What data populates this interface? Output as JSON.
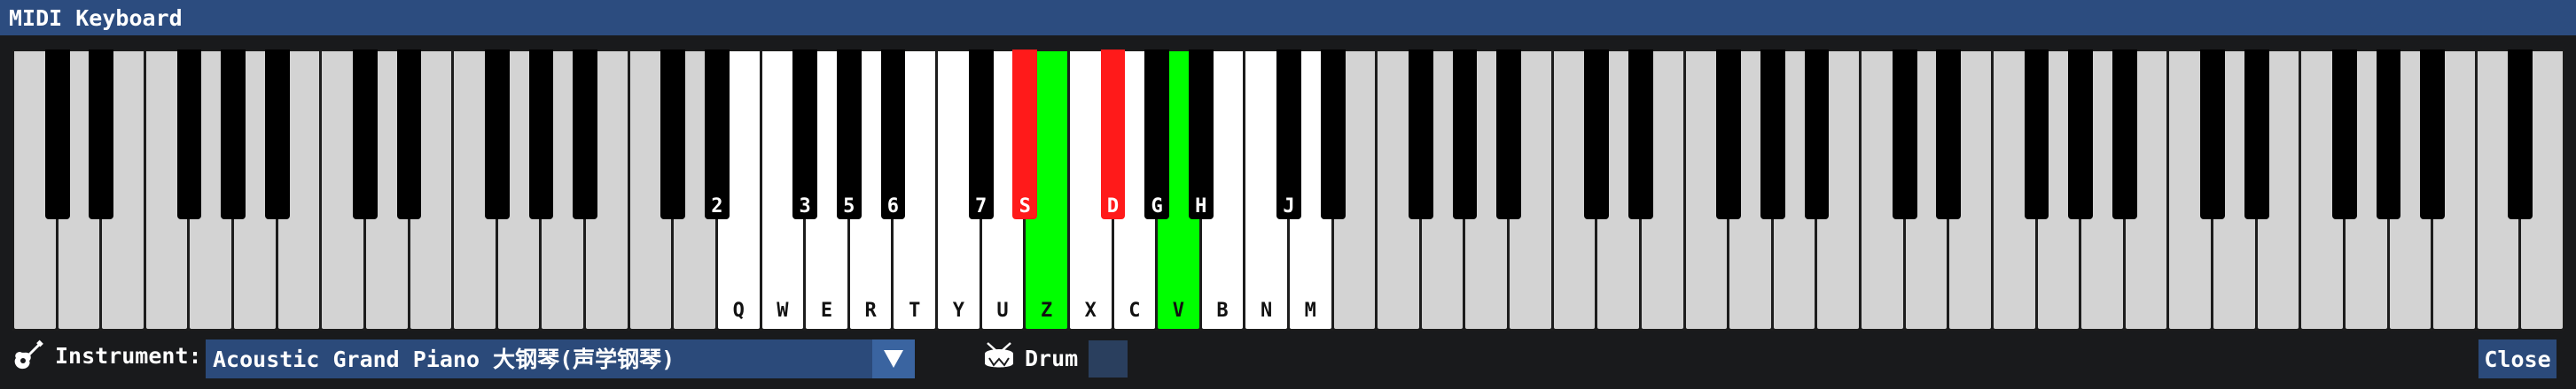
{
  "window": {
    "title": "MIDI Keyboard"
  },
  "keyboard": {
    "white_keys": [
      {
        "label": "",
        "state": "dim"
      },
      {
        "label": "",
        "state": "dim"
      },
      {
        "label": "",
        "state": "dim"
      },
      {
        "label": "",
        "state": "dim"
      },
      {
        "label": "",
        "state": "dim"
      },
      {
        "label": "",
        "state": "dim"
      },
      {
        "label": "",
        "state": "dim"
      },
      {
        "label": "",
        "state": "dim"
      },
      {
        "label": "",
        "state": "dim"
      },
      {
        "label": "",
        "state": "dim"
      },
      {
        "label": "",
        "state": "dim"
      },
      {
        "label": "",
        "state": "dim"
      },
      {
        "label": "",
        "state": "dim"
      },
      {
        "label": "",
        "state": "dim"
      },
      {
        "label": "",
        "state": "dim"
      },
      {
        "label": "",
        "state": "dim"
      },
      {
        "label": "Q",
        "state": "lit"
      },
      {
        "label": "W",
        "state": "lit"
      },
      {
        "label": "E",
        "state": "lit"
      },
      {
        "label": "R",
        "state": "lit"
      },
      {
        "label": "T",
        "state": "lit"
      },
      {
        "label": "Y",
        "state": "lit"
      },
      {
        "label": "U",
        "state": "lit"
      },
      {
        "label": "Z",
        "state": "green"
      },
      {
        "label": "X",
        "state": "lit"
      },
      {
        "label": "C",
        "state": "lit"
      },
      {
        "label": "V",
        "state": "green"
      },
      {
        "label": "B",
        "state": "lit"
      },
      {
        "label": "N",
        "state": "lit"
      },
      {
        "label": "M",
        "state": "lit"
      },
      {
        "label": "",
        "state": "dim"
      },
      {
        "label": "",
        "state": "dim"
      },
      {
        "label": "",
        "state": "dim"
      },
      {
        "label": "",
        "state": "dim"
      },
      {
        "label": "",
        "state": "dim"
      },
      {
        "label": "",
        "state": "dim"
      },
      {
        "label": "",
        "state": "dim"
      },
      {
        "label": "",
        "state": "dim"
      },
      {
        "label": "",
        "state": "dim"
      },
      {
        "label": "",
        "state": "dim"
      },
      {
        "label": "",
        "state": "dim"
      },
      {
        "label": "",
        "state": "dim"
      },
      {
        "label": "",
        "state": "dim"
      },
      {
        "label": "",
        "state": "dim"
      },
      {
        "label": "",
        "state": "dim"
      },
      {
        "label": "",
        "state": "dim"
      },
      {
        "label": "",
        "state": "dim"
      },
      {
        "label": "",
        "state": "dim"
      },
      {
        "label": "",
        "state": "dim"
      },
      {
        "label": "",
        "state": "dim"
      },
      {
        "label": "",
        "state": "dim"
      },
      {
        "label": "",
        "state": "dim"
      },
      {
        "label": "",
        "state": "dim"
      },
      {
        "label": "",
        "state": "dim"
      },
      {
        "label": "",
        "state": "dim"
      },
      {
        "label": "",
        "state": "dim"
      },
      {
        "label": "",
        "state": "dim"
      },
      {
        "label": "",
        "state": "dim"
      }
    ],
    "black_keys": [
      {
        "label": "",
        "state": "normal"
      },
      {
        "label": "",
        "state": "normal"
      },
      {
        "label": "",
        "state": "normal"
      },
      {
        "label": "",
        "state": "normal"
      },
      {
        "label": "",
        "state": "normal"
      },
      {
        "label": "",
        "state": "normal"
      },
      {
        "label": "",
        "state": "normal"
      },
      {
        "label": "",
        "state": "normal"
      },
      {
        "label": "",
        "state": "normal"
      },
      {
        "label": "",
        "state": "normal"
      },
      {
        "label": "",
        "state": "normal"
      },
      {
        "label": "2",
        "state": "normal"
      },
      {
        "label": "3",
        "state": "normal"
      },
      {
        "label": "5",
        "state": "normal"
      },
      {
        "label": "6",
        "state": "normal"
      },
      {
        "label": "7",
        "state": "normal"
      },
      {
        "label": "S",
        "state": "red"
      },
      {
        "label": "D",
        "state": "red"
      },
      {
        "label": "G",
        "state": "normal"
      },
      {
        "label": "H",
        "state": "normal"
      },
      {
        "label": "J",
        "state": "normal"
      },
      {
        "label": "",
        "state": "normal"
      },
      {
        "label": "",
        "state": "normal"
      },
      {
        "label": "",
        "state": "normal"
      },
      {
        "label": "",
        "state": "normal"
      },
      {
        "label": "",
        "state": "normal"
      },
      {
        "label": "",
        "state": "normal"
      },
      {
        "label": "",
        "state": "normal"
      },
      {
        "label": "",
        "state": "normal"
      },
      {
        "label": "",
        "state": "normal"
      },
      {
        "label": "",
        "state": "normal"
      },
      {
        "label": "",
        "state": "normal"
      },
      {
        "label": "",
        "state": "normal"
      },
      {
        "label": "",
        "state": "normal"
      },
      {
        "label": "",
        "state": "normal"
      },
      {
        "label": "",
        "state": "normal"
      },
      {
        "label": "",
        "state": "normal"
      },
      {
        "label": "",
        "state": "normal"
      },
      {
        "label": "",
        "state": "normal"
      },
      {
        "label": "",
        "state": "normal"
      },
      {
        "label": "",
        "state": "normal"
      }
    ]
  },
  "instrument": {
    "icon": "guitar-icon",
    "label": "Instrument:",
    "selected": "Acoustic Grand Piano 大钢琴(声学钢琴)",
    "dropdown_icon": "triangle-down-icon"
  },
  "drum": {
    "icon": "drum-icon",
    "label": "Drum",
    "checked": false
  },
  "close_button": {
    "label": "Close"
  },
  "colors": {
    "title_bar": "#2c4c7f",
    "background": "#191a1c",
    "pressed_white": "#00ff00",
    "pressed_black": "#ff1a1a",
    "white_key_mapped": "#ffffff",
    "white_key_unmapped": "#d3d3d3"
  }
}
